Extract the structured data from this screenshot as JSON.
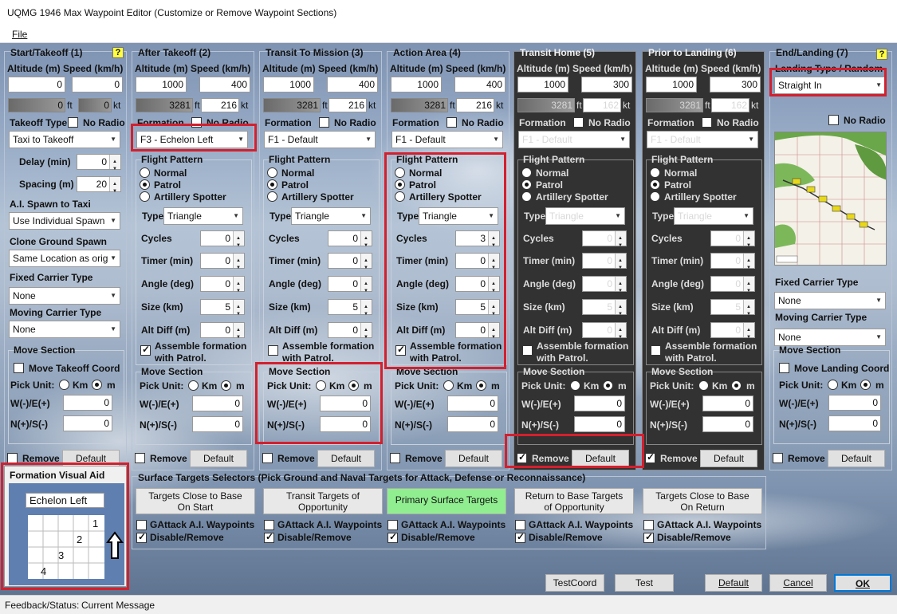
{
  "window": {
    "title": "UQMG 1946 Max Waypoint Editor (Customize or Remove Waypoint Sections)"
  },
  "menu": {
    "file": "File"
  },
  "labels": {
    "alt_speed": "Altitude (m) Speed (km/h)",
    "ft": "ft",
    "kt": "kt",
    "takeoff_type": "Takeoff Type",
    "no_radio": "No Radio",
    "delay": "Delay (min)",
    "spacing": "Spacing (m)",
    "ai_spawn": "A.I. Spawn to Taxi",
    "clone_ground": "Clone Ground Spawn",
    "fixed_carrier": "Fixed Carrier Type",
    "moving_carrier": "Moving Carrier Type",
    "move_section": "Move Section",
    "move_takeoff": "Move Takeoff Coord",
    "move_landing": "Move Landing Coord",
    "pick_unit": "Pick Unit:",
    "km": "Km",
    "m": "m",
    "we": "W(-)/E(+)",
    "ns": "N(+)/S(-)",
    "remove": "Remove",
    "default": "Default",
    "formation": "Formation",
    "flight_pattern": "Flight Pattern",
    "normal": "Normal",
    "patrol": "Patrol",
    "artillery": "Artillery Spotter",
    "type": "Type",
    "cycles": "Cycles",
    "timer": "Timer (min)",
    "angle": "Angle (deg)",
    "size": "Size (km)",
    "alt_diff": "Alt Diff (m)",
    "assemble1": "Assemble formation",
    "assemble2": "with Patrol.",
    "landing_type": "Landing Type / Random",
    "help": "?"
  },
  "start": {
    "title": "Start/Takeoff (1)",
    "alt": "0",
    "speed": "0",
    "ft": "0",
    "kt": "0",
    "takeoff_type": "Taxi to Takeoff",
    "delay": "0",
    "spacing": "20",
    "ai_spawn": "Use Individual Spawn",
    "clone_ground": "Same Location as orig",
    "fixed_carrier": "None",
    "moving_carrier": "None",
    "we": "0",
    "ns": "0"
  },
  "after": {
    "title": "After Takeoff (2)",
    "alt": "1000",
    "speed": "400",
    "ft": "3281",
    "kt": "216",
    "formation": "F3 - Echelon Left",
    "type": "Triangle",
    "cycles": "0",
    "timer": "0",
    "angle": "0",
    "size": "5",
    "alt_diff": "0",
    "we": "0",
    "ns": "0"
  },
  "transit": {
    "title": "Transit To Mission (3)",
    "alt": "1000",
    "speed": "400",
    "ft": "3281",
    "kt": "216",
    "formation": "F1 - Default",
    "type": "Triangle",
    "cycles": "0",
    "timer": "0",
    "angle": "0",
    "size": "5",
    "alt_diff": "0",
    "we": "0",
    "ns": "0"
  },
  "action": {
    "title": "Action Area (4)",
    "alt": "1000",
    "speed": "400",
    "ft": "3281",
    "kt": "216",
    "formation": "F1 - Default",
    "type": "Triangle",
    "cycles": "3",
    "timer": "0",
    "angle": "0",
    "size": "5",
    "alt_diff": "0",
    "we": "0",
    "ns": "0"
  },
  "home": {
    "title": "Transit Home (5)",
    "alt": "1000",
    "speed": "300",
    "ft": "3281",
    "kt": "162",
    "formation": "F1 - Default",
    "type": "Triangle",
    "cycles": "0",
    "timer": "0",
    "angle": "0",
    "size": "5",
    "alt_diff": "0",
    "we": "0",
    "ns": "0"
  },
  "prior": {
    "title": "Prior to Landing (6)",
    "alt": "1000",
    "speed": "300",
    "ft": "3281",
    "kt": "162",
    "formation": "F1 - Default",
    "type": "Triangle",
    "cycles": "0",
    "timer": "0",
    "angle": "0",
    "size": "5",
    "alt_diff": "0",
    "we": "0",
    "ns": "0"
  },
  "end": {
    "title": "End/Landing (7)",
    "landing_type": "Straight In",
    "fixed_carrier": "None",
    "moving_carrier": "None",
    "we": "0",
    "ns": "0"
  },
  "formation_aid": {
    "title": "Formation Visual Aid",
    "name": "Echelon Left",
    "cells": [
      "1",
      "2",
      "3",
      "4"
    ]
  },
  "surface": {
    "title": "Surface Targets Selectors (Pick Ground and Naval Targets for Attack, Defense or Reconnaissance)",
    "buttons": [
      {
        "line1": "Targets Close to Base",
        "line2": "On Start"
      },
      {
        "line1": "Transit Targets of",
        "line2": "Opportunity"
      },
      {
        "line1": "Primary Surface Targets",
        "line2": ""
      },
      {
        "line1": "Return to Base Targets",
        "line2": "of Opportunity"
      },
      {
        "line1": "Targets Close to Base",
        "line2": "On Return"
      }
    ],
    "gattack": "GAttack A.I. Waypoints",
    "disable": "Disable/Remove"
  },
  "bottom": {
    "testcoord": "TestCoord",
    "test": "Test",
    "default": "Default",
    "cancel": "Cancel",
    "ok": "OK"
  },
  "status": {
    "label": "Feedback/Status:",
    "message": "Current Message"
  },
  "colors": {
    "highlight": "#d2202e",
    "primary_button": "#90ee90",
    "dark_panel": "#323232",
    "help_icon": "#ffff40"
  }
}
